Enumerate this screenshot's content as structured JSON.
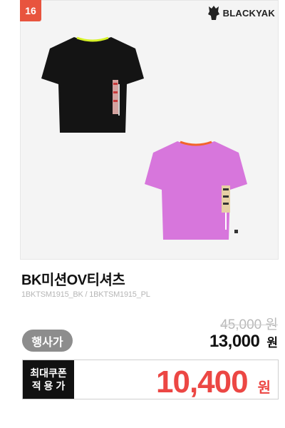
{
  "rank_badge": "16",
  "brand": {
    "name": "BLACKYAK"
  },
  "product": {
    "name": "BK미션OV티셔츠",
    "codes": "1BKTSM1915_BK / 1BKTSM1915_PL",
    "original_price": "45,000 원",
    "sale_badge": "행사가",
    "sale_price": "13,000",
    "sale_unit": "원"
  },
  "coupon": {
    "label_line1": "최대쿠폰",
    "label_line2": "적 용 가",
    "price": "10,400",
    "unit": "원"
  },
  "colors": {
    "accent_red": "#ec4744",
    "rank_bg": "#e8543e",
    "badge_gray": "#8d8d8d",
    "shirt_black": "#141414",
    "shirt_pink": "#d776dc"
  }
}
